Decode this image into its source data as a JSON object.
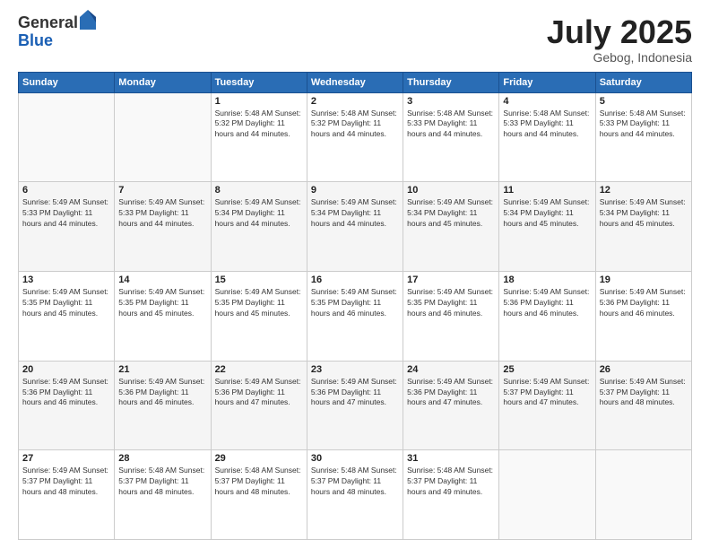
{
  "header": {
    "logo_general": "General",
    "logo_blue": "Blue",
    "month_title": "July 2025",
    "location": "Gebog, Indonesia"
  },
  "weekdays": [
    "Sunday",
    "Monday",
    "Tuesday",
    "Wednesday",
    "Thursday",
    "Friday",
    "Saturday"
  ],
  "weeks": [
    [
      {
        "day": "",
        "info": ""
      },
      {
        "day": "",
        "info": ""
      },
      {
        "day": "1",
        "info": "Sunrise: 5:48 AM\nSunset: 5:32 PM\nDaylight: 11 hours and 44 minutes."
      },
      {
        "day": "2",
        "info": "Sunrise: 5:48 AM\nSunset: 5:32 PM\nDaylight: 11 hours and 44 minutes."
      },
      {
        "day": "3",
        "info": "Sunrise: 5:48 AM\nSunset: 5:33 PM\nDaylight: 11 hours and 44 minutes."
      },
      {
        "day": "4",
        "info": "Sunrise: 5:48 AM\nSunset: 5:33 PM\nDaylight: 11 hours and 44 minutes."
      },
      {
        "day": "5",
        "info": "Sunrise: 5:48 AM\nSunset: 5:33 PM\nDaylight: 11 hours and 44 minutes."
      }
    ],
    [
      {
        "day": "6",
        "info": "Sunrise: 5:49 AM\nSunset: 5:33 PM\nDaylight: 11 hours and 44 minutes."
      },
      {
        "day": "7",
        "info": "Sunrise: 5:49 AM\nSunset: 5:33 PM\nDaylight: 11 hours and 44 minutes."
      },
      {
        "day": "8",
        "info": "Sunrise: 5:49 AM\nSunset: 5:34 PM\nDaylight: 11 hours and 44 minutes."
      },
      {
        "day": "9",
        "info": "Sunrise: 5:49 AM\nSunset: 5:34 PM\nDaylight: 11 hours and 44 minutes."
      },
      {
        "day": "10",
        "info": "Sunrise: 5:49 AM\nSunset: 5:34 PM\nDaylight: 11 hours and 45 minutes."
      },
      {
        "day": "11",
        "info": "Sunrise: 5:49 AM\nSunset: 5:34 PM\nDaylight: 11 hours and 45 minutes."
      },
      {
        "day": "12",
        "info": "Sunrise: 5:49 AM\nSunset: 5:34 PM\nDaylight: 11 hours and 45 minutes."
      }
    ],
    [
      {
        "day": "13",
        "info": "Sunrise: 5:49 AM\nSunset: 5:35 PM\nDaylight: 11 hours and 45 minutes."
      },
      {
        "day": "14",
        "info": "Sunrise: 5:49 AM\nSunset: 5:35 PM\nDaylight: 11 hours and 45 minutes."
      },
      {
        "day": "15",
        "info": "Sunrise: 5:49 AM\nSunset: 5:35 PM\nDaylight: 11 hours and 45 minutes."
      },
      {
        "day": "16",
        "info": "Sunrise: 5:49 AM\nSunset: 5:35 PM\nDaylight: 11 hours and 46 minutes."
      },
      {
        "day": "17",
        "info": "Sunrise: 5:49 AM\nSunset: 5:35 PM\nDaylight: 11 hours and 46 minutes."
      },
      {
        "day": "18",
        "info": "Sunrise: 5:49 AM\nSunset: 5:36 PM\nDaylight: 11 hours and 46 minutes."
      },
      {
        "day": "19",
        "info": "Sunrise: 5:49 AM\nSunset: 5:36 PM\nDaylight: 11 hours and 46 minutes."
      }
    ],
    [
      {
        "day": "20",
        "info": "Sunrise: 5:49 AM\nSunset: 5:36 PM\nDaylight: 11 hours and 46 minutes."
      },
      {
        "day": "21",
        "info": "Sunrise: 5:49 AM\nSunset: 5:36 PM\nDaylight: 11 hours and 46 minutes."
      },
      {
        "day": "22",
        "info": "Sunrise: 5:49 AM\nSunset: 5:36 PM\nDaylight: 11 hours and 47 minutes."
      },
      {
        "day": "23",
        "info": "Sunrise: 5:49 AM\nSunset: 5:36 PM\nDaylight: 11 hours and 47 minutes."
      },
      {
        "day": "24",
        "info": "Sunrise: 5:49 AM\nSunset: 5:36 PM\nDaylight: 11 hours and 47 minutes."
      },
      {
        "day": "25",
        "info": "Sunrise: 5:49 AM\nSunset: 5:37 PM\nDaylight: 11 hours and 47 minutes."
      },
      {
        "day": "26",
        "info": "Sunrise: 5:49 AM\nSunset: 5:37 PM\nDaylight: 11 hours and 48 minutes."
      }
    ],
    [
      {
        "day": "27",
        "info": "Sunrise: 5:49 AM\nSunset: 5:37 PM\nDaylight: 11 hours and 48 minutes."
      },
      {
        "day": "28",
        "info": "Sunrise: 5:48 AM\nSunset: 5:37 PM\nDaylight: 11 hours and 48 minutes."
      },
      {
        "day": "29",
        "info": "Sunrise: 5:48 AM\nSunset: 5:37 PM\nDaylight: 11 hours and 48 minutes."
      },
      {
        "day": "30",
        "info": "Sunrise: 5:48 AM\nSunset: 5:37 PM\nDaylight: 11 hours and 48 minutes."
      },
      {
        "day": "31",
        "info": "Sunrise: 5:48 AM\nSunset: 5:37 PM\nDaylight: 11 hours and 49 minutes."
      },
      {
        "day": "",
        "info": ""
      },
      {
        "day": "",
        "info": ""
      }
    ]
  ]
}
